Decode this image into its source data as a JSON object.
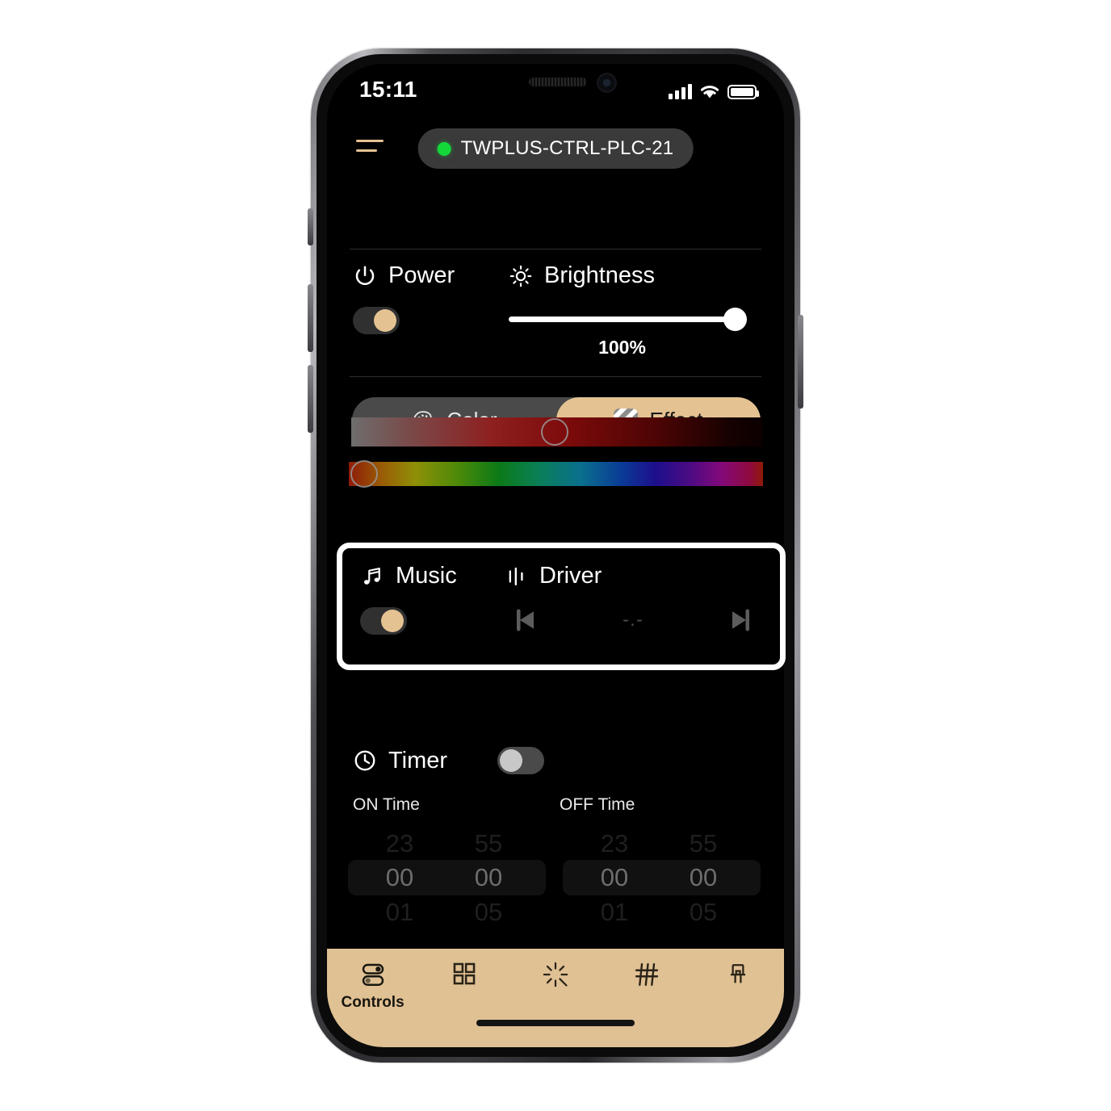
{
  "status_bar": {
    "time": "15:11",
    "cellular_icon": "cellular-bars-icon",
    "wifi_icon": "wifi-icon",
    "battery_icon": "battery-full-icon"
  },
  "header": {
    "menu_icon": "hamburger-menu-icon",
    "device_name": "TWPLUS-CTRL-PLC-21",
    "connection_status_color": "#14d83a"
  },
  "power": {
    "label": "Power",
    "icon": "power-icon",
    "state": "on"
  },
  "brightness": {
    "label": "Brightness",
    "icon": "sun-brightness-icon",
    "value": "100%",
    "percent": 100
  },
  "mode_tabs": [
    {
      "label": "Color",
      "icon": "palette-icon",
      "active": false
    },
    {
      "label": "Effect",
      "icon": "effect-stripes-icon",
      "active": true
    }
  ],
  "color_sliders": {
    "saturation": {
      "name": "saturation-slider",
      "handle_percent": 46
    },
    "hue": {
      "name": "hue-slider",
      "handle_percent": 2
    }
  },
  "music": {
    "label": "Music",
    "icon": "music-note-icon",
    "state": "on"
  },
  "driver": {
    "label": "Driver",
    "icon": "audio-bars-icon",
    "prev_icon": "skip-previous-icon",
    "next_icon": "skip-next-icon",
    "value": "-.-"
  },
  "timer": {
    "label": "Timer",
    "icon": "clock-icon",
    "state": "off",
    "on_time_label": "ON Time",
    "off_time_label": "OFF Time",
    "on_time": {
      "hours": {
        "prev": "23",
        "current": "00",
        "next": "01"
      },
      "minutes": {
        "prev": "55",
        "current": "00",
        "next": "05"
      }
    },
    "off_time": {
      "hours": {
        "prev": "23",
        "current": "00",
        "next": "01"
      },
      "minutes": {
        "prev": "55",
        "current": "00",
        "next": "05"
      }
    }
  },
  "bottom_nav": {
    "background_color": "#e0c194",
    "items": [
      {
        "label": "Controls",
        "icon": "sliders-toggles-icon",
        "active": true
      },
      {
        "label": "",
        "icon": "grid-squares-icon",
        "active": false
      },
      {
        "label": "",
        "icon": "sparkle-burst-icon",
        "active": false
      },
      {
        "label": "",
        "icon": "mesh-grid-icon",
        "active": false
      },
      {
        "label": "",
        "icon": "led-chip-icon",
        "active": false
      }
    ]
  },
  "theme": {
    "accent": "#e4c292",
    "background": "#000000",
    "text": "#ffffff"
  }
}
